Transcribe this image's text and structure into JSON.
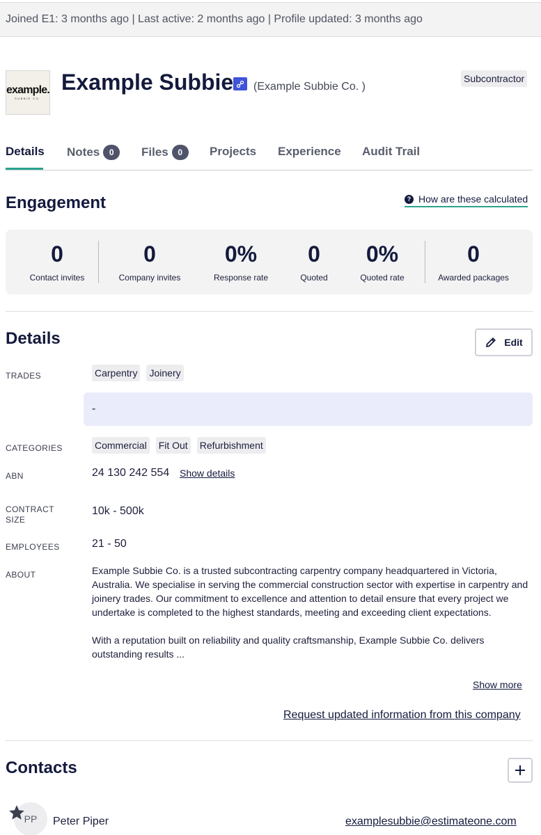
{
  "topbar": {
    "meta": "Joined E1: 3 months ago | Last active: 2 months ago | Profile updated: 3 months ago"
  },
  "company": {
    "logo_text": "example.",
    "logo_subtext": "SUBBIE CO.",
    "name": "Example Subbie",
    "link_icon": "link-icon",
    "legal_name": "(Example Subbie Co. )",
    "type_badge": "Subcontractor"
  },
  "tabs": [
    {
      "label": "Details",
      "active": true
    },
    {
      "label": "Notes",
      "count": "0"
    },
    {
      "label": "Files",
      "count": "0"
    },
    {
      "label": "Projects"
    },
    {
      "label": "Experience"
    },
    {
      "label": "Audit Trail"
    }
  ],
  "colors": {
    "accent": "#2aa38c",
    "navy": "#141a3d",
    "link_badge": "#3e54d9",
    "note_bg": "#eaebfb"
  },
  "engagement": {
    "title": "Engagement",
    "help_link": "How are these calculated",
    "stats": [
      {
        "value": "0",
        "label": "Contact invites"
      },
      {
        "value": "0",
        "label": "Company invites"
      },
      {
        "value": "0%",
        "label": "Response rate"
      },
      {
        "value": "0",
        "label": "Quoted"
      },
      {
        "value": "0%",
        "label": "Quoted rate"
      },
      {
        "value": "0",
        "label": "Awarded packages"
      }
    ]
  },
  "details": {
    "title": "Details",
    "edit_label": "Edit",
    "trades_label": "TRADES",
    "trades": [
      "Carpentry",
      "Joinery"
    ],
    "note_value": "-",
    "categories_label": "CATEGORIES",
    "categories": [
      "Commercial",
      "Fit Out",
      "Refurbishment"
    ],
    "abn_label": "ABN",
    "abn": "24 130 242 554",
    "abn_link": "Show details",
    "contract_size_label_1": "CONTRACT",
    "contract_size_label_2": "SIZE",
    "contract_size": "10k - 500k",
    "employees_label": "EMPLOYEES",
    "employees": "21 - 50",
    "about_label": "ABOUT",
    "about_p1": "Example Subbie Co. is a trusted subcontracting carpentry company headquartered in Victoria, Australia. We specialise in serving the commercial construction sector with expertise in carpentry and joinery trades. Our commitment to excellence and attention to detail ensure that every project we undertake is completed to the highest standards, meeting and exceeding client expectations.",
    "about_p2": "With a reputation built on reliability and quality craftsmanship, Example Subbie Co. delivers outstanding results ...",
    "show_more": "Show more",
    "request_link": "Request updated information from this company"
  },
  "contacts": {
    "title": "Contacts",
    "items": [
      {
        "initials": "PP",
        "name": "Peter Piper",
        "email": "examplesubbie@estimateone.com"
      }
    ]
  }
}
